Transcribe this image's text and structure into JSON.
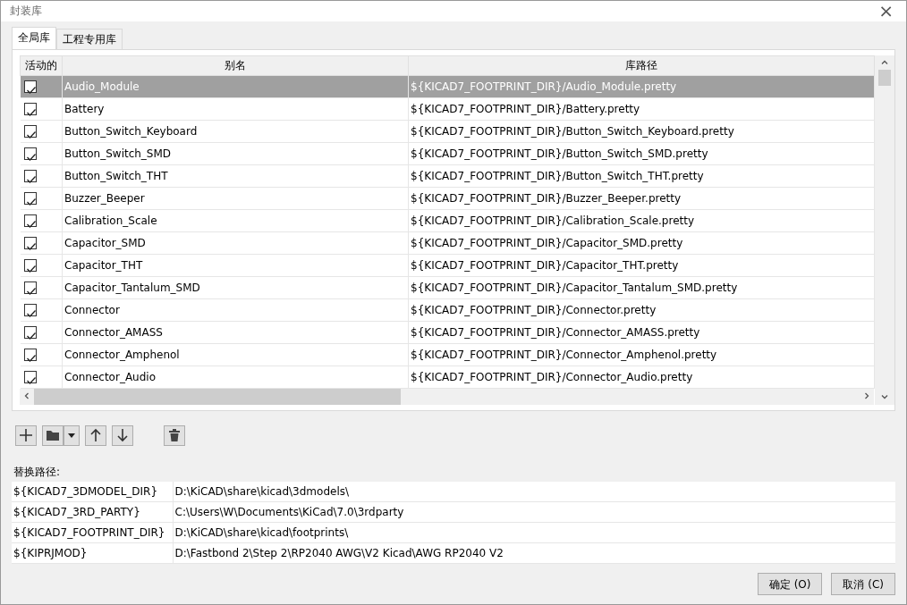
{
  "window": {
    "title": "封装库",
    "close": "×"
  },
  "tabs": [
    {
      "label": "全局库",
      "selected": true
    },
    {
      "label": "工程专用库",
      "selected": false
    }
  ],
  "library_table": {
    "columns": [
      "活动的",
      "别名",
      "库路径"
    ],
    "rows": [
      {
        "active": true,
        "alias": "Audio_Module",
        "path": "${KICAD7_FOOTPRINT_DIR}/Audio_Module.pretty",
        "selected": true
      },
      {
        "active": true,
        "alias": "Battery",
        "path": "${KICAD7_FOOTPRINT_DIR}/Battery.pretty",
        "selected": false
      },
      {
        "active": true,
        "alias": "Button_Switch_Keyboard",
        "path": "${KICAD7_FOOTPRINT_DIR}/Button_Switch_Keyboard.pretty",
        "selected": false
      },
      {
        "active": true,
        "alias": "Button_Switch_SMD",
        "path": "${KICAD7_FOOTPRINT_DIR}/Button_Switch_SMD.pretty",
        "selected": false
      },
      {
        "active": true,
        "alias": "Button_Switch_THT",
        "path": "${KICAD7_FOOTPRINT_DIR}/Button_Switch_THT.pretty",
        "selected": false
      },
      {
        "active": true,
        "alias": "Buzzer_Beeper",
        "path": "${KICAD7_FOOTPRINT_DIR}/Buzzer_Beeper.pretty",
        "selected": false
      },
      {
        "active": true,
        "alias": "Calibration_Scale",
        "path": "${KICAD7_FOOTPRINT_DIR}/Calibration_Scale.pretty",
        "selected": false
      },
      {
        "active": true,
        "alias": "Capacitor_SMD",
        "path": "${KICAD7_FOOTPRINT_DIR}/Capacitor_SMD.pretty",
        "selected": false
      },
      {
        "active": true,
        "alias": "Capacitor_THT",
        "path": "${KICAD7_FOOTPRINT_DIR}/Capacitor_THT.pretty",
        "selected": false
      },
      {
        "active": true,
        "alias": "Capacitor_Tantalum_SMD",
        "path": "${KICAD7_FOOTPRINT_DIR}/Capacitor_Tantalum_SMD.pretty",
        "selected": false
      },
      {
        "active": true,
        "alias": "Connector",
        "path": "${KICAD7_FOOTPRINT_DIR}/Connector.pretty",
        "selected": false
      },
      {
        "active": true,
        "alias": "Connector_AMASS",
        "path": "${KICAD7_FOOTPRINT_DIR}/Connector_AMASS.pretty",
        "selected": false
      },
      {
        "active": true,
        "alias": "Connector_Amphenol",
        "path": "${KICAD7_FOOTPRINT_DIR}/Connector_Amphenol.pretty",
        "selected": false
      },
      {
        "active": true,
        "alias": "Connector_Audio",
        "path": "${KICAD7_FOOTPRINT_DIR}/Connector_Audio.pretty",
        "selected": false
      }
    ]
  },
  "path_substitutions": {
    "label": "替换路径:",
    "rows": [
      {
        "name": "${KICAD7_3DMODEL_DIR}",
        "value": "D:\\KiCAD\\share\\kicad\\3dmodels\\"
      },
      {
        "name": "${KICAD7_3RD_PARTY}",
        "value": "C:\\Users\\W\\Documents\\KiCad\\7.0\\3rdparty"
      },
      {
        "name": "${KICAD7_FOOTPRINT_DIR}",
        "value": "D:\\KiCAD\\share\\kicad\\footprints\\"
      },
      {
        "name": "${KIPRJMOD}",
        "value": "D:\\Fastbond 2\\Step 2\\RP2040 AWG\\V2 Kicad\\AWG RP2040 V2"
      }
    ]
  },
  "buttons": [
    "确定 (O)",
    "取消 (C)"
  ]
}
